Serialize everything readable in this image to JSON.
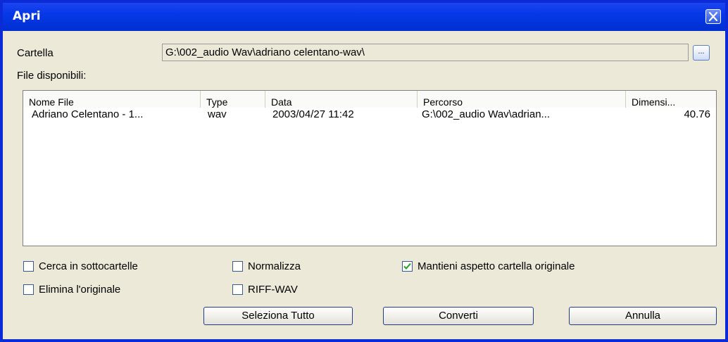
{
  "window": {
    "title": "Apri"
  },
  "folder": {
    "label": "Cartella",
    "path": "G:\\002_audio Wav\\adriano celentano-wav\\",
    "browse_label": "..."
  },
  "files": {
    "label": "File disponibili:",
    "columns": [
      "Nome File",
      "Type",
      "Data",
      "Percorso",
      "Dimensi..."
    ],
    "rows": [
      [
        "Adriano Celentano - 1...",
        "wav",
        "2003/04/27 11:42",
        "G:\\002_audio Wav\\adrian...",
        "40.76"
      ]
    ]
  },
  "options": {
    "search_subfolders": {
      "label": "Cerca in sottocartelle",
      "checked": false
    },
    "normalize": {
      "label": "Normalizza",
      "checked": false
    },
    "keep_folder_structure": {
      "label": "Mantieni aspetto cartella originale",
      "checked": true
    },
    "delete_original": {
      "label": "Elimina l'originale",
      "checked": false
    },
    "riff_wav": {
      "label": "RIFF-WAV",
      "checked": false
    }
  },
  "buttons": {
    "select_all": "Seleziona Tutto",
    "convert": "Converti",
    "cancel": "Annulla"
  },
  "colors": {
    "titlebar": "#0638e8",
    "frame": "#0a2bd6",
    "check_mark": "#21a121"
  }
}
